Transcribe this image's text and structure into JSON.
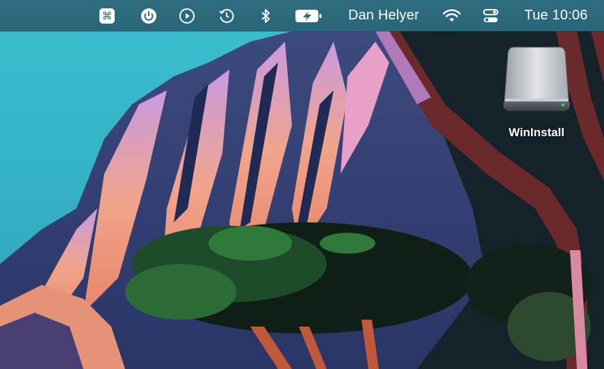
{
  "menubar": {
    "user_name": "Dan Helyer",
    "clock": "Tue 10:06",
    "icons": [
      "command-icon",
      "power-icon",
      "play-icon",
      "time-machine-icon",
      "bluetooth-icon",
      "battery-charging-icon",
      "wifi-icon",
      "control-center-icon"
    ]
  },
  "desktop": {
    "drive_label": "WinInstall"
  },
  "colors": {
    "menubar": "#2c687b",
    "sky": "#35b3c4",
    "accent_peach": "#e89a82"
  }
}
